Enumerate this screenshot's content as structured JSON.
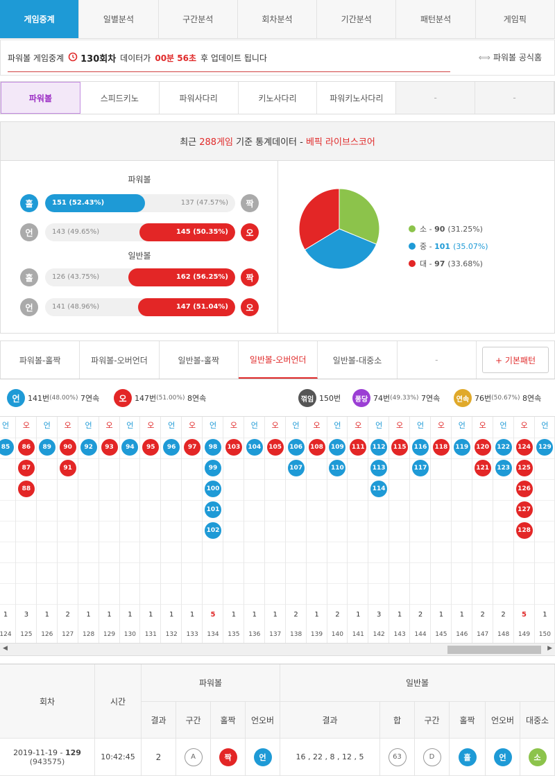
{
  "topnav": [
    "게임중계",
    "일별분석",
    "구간분석",
    "회차분석",
    "기간분석",
    "패턴분석",
    "게임픽"
  ],
  "status": {
    "prefix": "파워볼 게임중계",
    "round": "130회차",
    "middle": "데이터가",
    "remain": "00분 56초",
    "suffix": "후 업데이트 됩니다",
    "link": "파워볼 공식홈"
  },
  "gamenav": [
    "파워볼",
    "스피드키노",
    "파워사다리",
    "키노사다리",
    "파워키노사다리",
    "-",
    "-"
  ],
  "stats": {
    "head_pre": "최근",
    "head_count": "288게임",
    "head_mid": "기준 통계데이터 -",
    "head_brand": "베픽 라이브스코어",
    "pb_title": "파워볼",
    "nb_title": "일반볼",
    "rows": [
      {
        "left_icon": "홀",
        "right_icon": "짝",
        "left_label": "151 (52.43%)",
        "right_label": "137 (47.57%)",
        "left_pct": 52.43,
        "winner": "left"
      },
      {
        "left_icon": "언",
        "right_icon": "오",
        "left_label": "143 (49.65%)",
        "right_label": "145 (50.35%)",
        "left_pct": 49.65,
        "winner": "right"
      },
      {
        "left_icon": "홀",
        "right_icon": "짝",
        "left_label": "126 (43.75%)",
        "right_label": "162 (56.25%)",
        "left_pct": 43.75,
        "winner": "right"
      },
      {
        "left_icon": "언",
        "right_icon": "오",
        "left_label": "141 (48.96%)",
        "right_label": "147 (51.04%)",
        "left_pct": 48.96,
        "winner": "right"
      }
    ],
    "pie": [
      {
        "label": "소",
        "value": 90,
        "pct": "(31.25%)",
        "color": "#8cc34b"
      },
      {
        "label": "중",
        "value": 101,
        "pct": "(35.07%)",
        "color": "#1e9ad6"
      },
      {
        "label": "대",
        "value": 97,
        "pct": "(33.68%)",
        "color": "#e32626"
      }
    ]
  },
  "tabs2": [
    "파워볼-홀짝",
    "파워볼-오버언더",
    "일반볼-홀짝",
    "일반볼-오버언더",
    "일반볼-대중소",
    "-",
    "+ 기본패턴"
  ],
  "summary": {
    "under_icon": "언",
    "under_count": "141번",
    "under_pct": "(48.00%)",
    "under_streak": "7연속",
    "over_icon": "오",
    "over_count": "147번",
    "over_pct": "(51.00%)",
    "over_streak": "8연속",
    "break_icon": "꺾임",
    "break_count": "150번",
    "pong_icon": "퐁당",
    "pong_count": "74번",
    "pong_pct": "(49.33%)",
    "pong_streak": "7연속",
    "streak_icon": "연속",
    "streak_count": "76번",
    "streak_pct": "(50.67%)",
    "streak_streak": "8연속"
  },
  "grid": [
    {
      "type": "언",
      "balls": [
        "85"
      ],
      "count": "1",
      "round": "124"
    },
    {
      "type": "오",
      "balls": [
        "86",
        "87",
        "88"
      ],
      "count": "3",
      "round": "125"
    },
    {
      "type": "언",
      "balls": [
        "89"
      ],
      "count": "1",
      "round": "126"
    },
    {
      "type": "오",
      "balls": [
        "90",
        "91"
      ],
      "count": "2",
      "round": "127"
    },
    {
      "type": "언",
      "balls": [
        "92"
      ],
      "count": "1",
      "round": "128"
    },
    {
      "type": "오",
      "balls": [
        "93"
      ],
      "count": "1",
      "round": "129"
    },
    {
      "type": "언",
      "balls": [
        "94"
      ],
      "count": "1",
      "round": "130"
    },
    {
      "type": "오",
      "balls": [
        "95"
      ],
      "count": "1",
      "round": "131"
    },
    {
      "type": "언",
      "balls": [
        "96"
      ],
      "count": "1",
      "round": "132"
    },
    {
      "type": "오",
      "balls": [
        "97"
      ],
      "count": "1",
      "round": "133"
    },
    {
      "type": "언",
      "balls": [
        "98",
        "99",
        "100",
        "101",
        "102"
      ],
      "count": "5",
      "round": "134"
    },
    {
      "type": "오",
      "balls": [
        "103"
      ],
      "count": "1",
      "round": "135"
    },
    {
      "type": "언",
      "balls": [
        "104"
      ],
      "count": "1",
      "round": "136"
    },
    {
      "type": "오",
      "balls": [
        "105"
      ],
      "count": "1",
      "round": "137"
    },
    {
      "type": "언",
      "balls": [
        "106",
        "107"
      ],
      "count": "2",
      "round": "138"
    },
    {
      "type": "오",
      "balls": [
        "108"
      ],
      "count": "1",
      "round": "139"
    },
    {
      "type": "언",
      "balls": [
        "109",
        "110"
      ],
      "count": "2",
      "round": "140"
    },
    {
      "type": "오",
      "balls": [
        "111"
      ],
      "count": "1",
      "round": "141"
    },
    {
      "type": "언",
      "balls": [
        "112",
        "113",
        "114"
      ],
      "count": "3",
      "round": "142"
    },
    {
      "type": "오",
      "balls": [
        "115"
      ],
      "count": "1",
      "round": "143"
    },
    {
      "type": "언",
      "balls": [
        "116",
        "117"
      ],
      "count": "2",
      "round": "144"
    },
    {
      "type": "오",
      "balls": [
        "118"
      ],
      "count": "1",
      "round": "145"
    },
    {
      "type": "언",
      "balls": [
        "119"
      ],
      "count": "1",
      "round": "146"
    },
    {
      "type": "오",
      "balls": [
        "120",
        "121"
      ],
      "count": "2",
      "round": "147"
    },
    {
      "type": "언",
      "balls": [
        "122",
        "123"
      ],
      "count": "2",
      "round": "148"
    },
    {
      "type": "오",
      "balls": [
        "124",
        "125",
        "126",
        "127",
        "128"
      ],
      "count": "5",
      "round": "149"
    },
    {
      "type": "언",
      "balls": [
        "129"
      ],
      "count": "1",
      "round": "150"
    }
  ],
  "table": {
    "h_round": "회차",
    "h_time": "시간",
    "h_pb": "파워볼",
    "h_nb": "일반볼",
    "sub": [
      "결과",
      "구간",
      "홀짝",
      "언오버",
      "결과",
      "합",
      "구간",
      "홀짝",
      "언오버",
      "대중소"
    ],
    "row": {
      "date": "2019-11-19 -",
      "round": "129",
      "id": "(943575)",
      "time": "10:42:45",
      "pb_result": "2",
      "pb_zone": "A",
      "pb_oe": "짝",
      "pb_ou": "언",
      "nb_result": "16 , 22 , 8 , 12 , 5",
      "nb_sum": "63",
      "nb_zone": "D",
      "nb_oe": "홀",
      "nb_ou": "언",
      "nb_size": "소"
    }
  }
}
